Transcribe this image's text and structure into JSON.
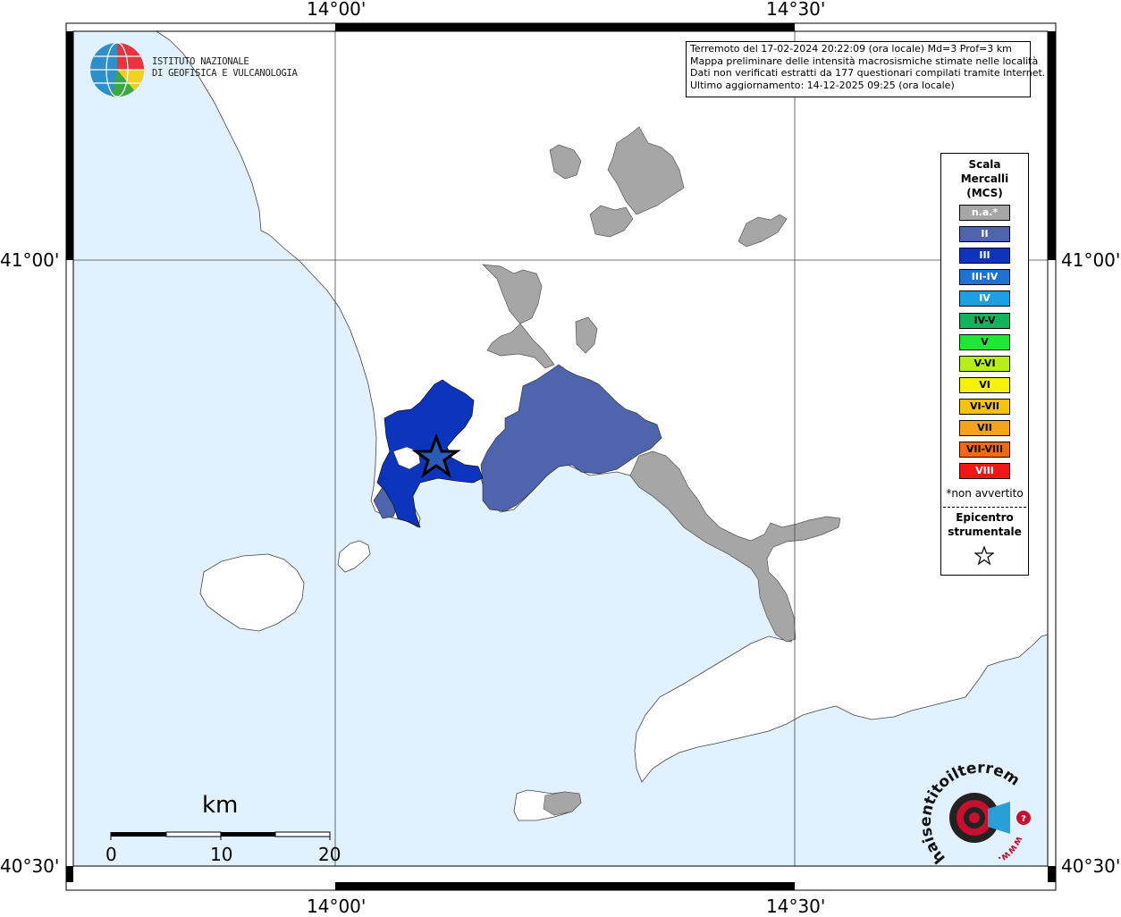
{
  "header": {
    "event_line": "Terremoto del 17-02-2024 20:22:09 (ora locale) Md=3 Prof=3 km",
    "map_line": "Mappa preliminare delle intensità macrosismiche stimate nelle località",
    "data_line": "Dati non verificati estratti da 177 questionari compilati tramite Internet.",
    "update_line": "Ultimo aggiornamento: 14-12-2025 09:25 (ora locale)"
  },
  "logo": {
    "line1": "ISTITUTO NAZIONALE",
    "line2": "DI GEOFISICA E VULCANOLOGIA",
    "icon": "ingv-globe-logo"
  },
  "coords": {
    "top_left": "14°00'",
    "top_right": "14°30'",
    "bottom_left": "14°00'",
    "bottom_right": "14°30'",
    "left_upper": "41°00'",
    "left_lower": "40°30'",
    "right_upper": "41°00'",
    "right_lower": "40°30'"
  },
  "scale": {
    "unit": "km",
    "ticks": [
      "0",
      "10",
      "20"
    ]
  },
  "legend": {
    "title_1": "Scala",
    "title_2": "Mercalli",
    "title_3": "(MCS)",
    "items": [
      {
        "label": "n.a.*",
        "color": "#a6a6a6",
        "text_color": "#ffffff"
      },
      {
        "label": "II",
        "color": "#4e65ad",
        "text_color": "#ffffff"
      },
      {
        "label": "III",
        "color": "#0c34bd",
        "text_color": "#ffffff"
      },
      {
        "label": "III-IV",
        "color": "#1f72d1",
        "text_color": "#ffffff"
      },
      {
        "label": "IV",
        "color": "#1ba0e3",
        "text_color": "#ffffff"
      },
      {
        "label": "IV-V",
        "color": "#12b35a",
        "text_color": "#000000"
      },
      {
        "label": "V",
        "color": "#22e636",
        "text_color": "#000000"
      },
      {
        "label": "V-VI",
        "color": "#b8ee17",
        "text_color": "#000000"
      },
      {
        "label": "VI",
        "color": "#f5f10a",
        "text_color": "#000000"
      },
      {
        "label": "VI-VII",
        "color": "#f3c30f",
        "text_color": "#000000"
      },
      {
        "label": "VII",
        "color": "#f8a11a",
        "text_color": "#000000"
      },
      {
        "label": "VII-VIII",
        "color": "#f36a0c",
        "text_color": "#000000"
      },
      {
        "label": "VIII",
        "color": "#ee1616",
        "text_color": "#ffffff"
      }
    ],
    "not_felt_note": "*non avvertito",
    "epicenter_1": "Epicentro",
    "epicenter_2": "strumentale"
  },
  "site_logo": {
    "text": "haisentitoilterremoto.it",
    "prefix": "www."
  },
  "colors": {
    "sea": "#e1f1fd",
    "land": "#ffffff",
    "not_available": "#a6a6a6",
    "intensity_II": "#4e65ad",
    "intensity_III": "#0c34bd"
  }
}
